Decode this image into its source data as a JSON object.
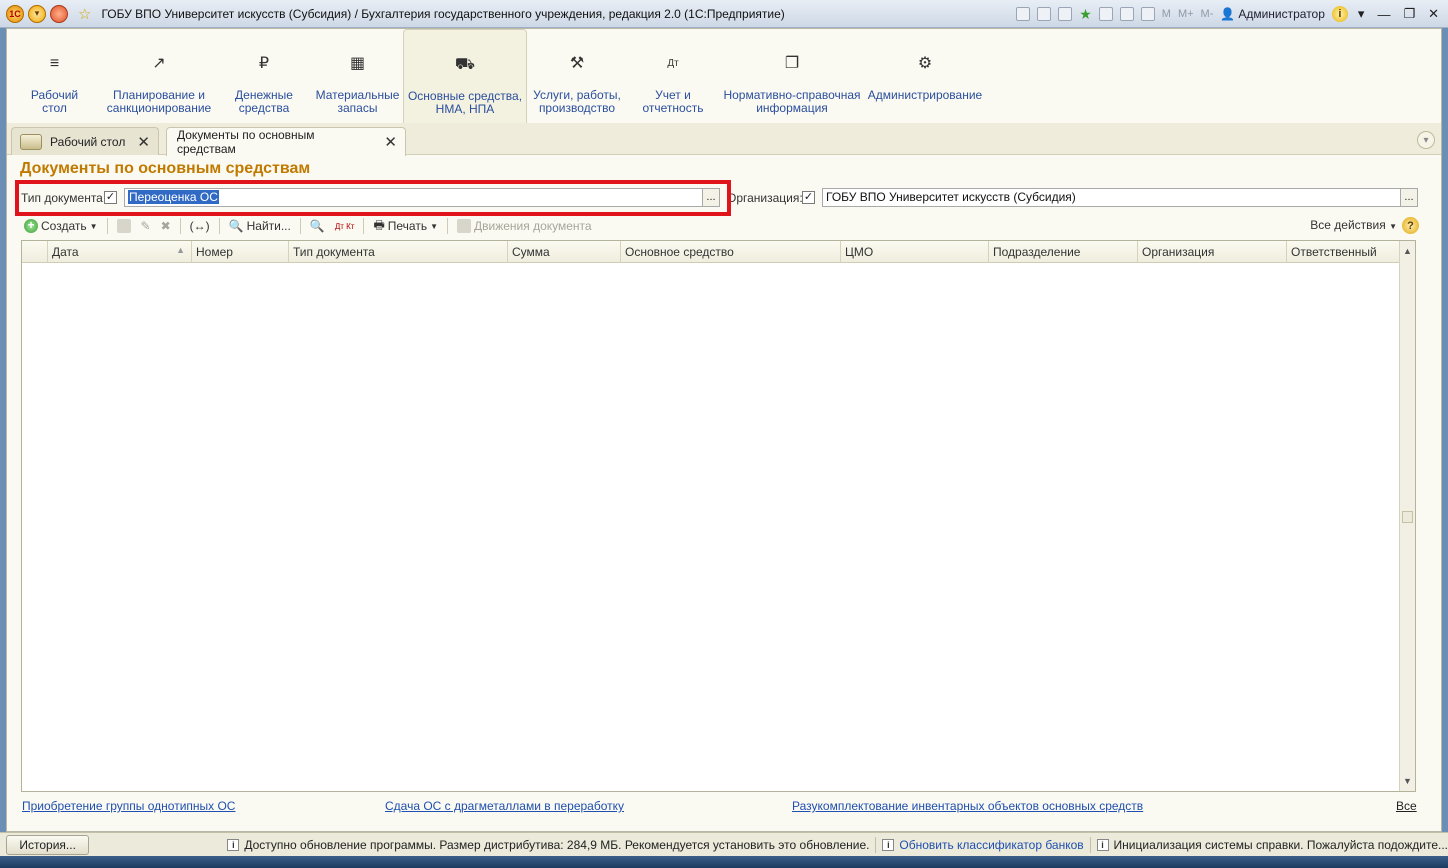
{
  "window": {
    "title": "ГОБУ ВПО Университет искусств (Субсидия) / Бухгалтерия государственного учреждения, редакция 2.0  (1С:Предприятие)",
    "logo_text": "1С",
    "memory_buttons": [
      "M",
      "M+",
      "M-"
    ],
    "user": "Администратор",
    "info_glyph": "i"
  },
  "sections": [
    {
      "label1": "Рабочий",
      "label2": "стол",
      "icon": "menu-lines-icon",
      "glyph": "≡"
    },
    {
      "label1": "Планирование и",
      "label2": "санкционирование",
      "icon": "planning-chart-icon",
      "glyph": "↗"
    },
    {
      "label1": "Денежные",
      "label2": "средства",
      "icon": "ruble-coin-icon",
      "glyph": "₽"
    },
    {
      "label1": "Материальные",
      "label2": "запасы",
      "icon": "grid-blocks-icon",
      "glyph": "▦"
    },
    {
      "label1": "Основные средства,",
      "label2": "НМА, НПА",
      "icon": "truck-icon",
      "glyph": "⛟"
    },
    {
      "label1": "Услуги, работы,",
      "label2": "производство",
      "icon": "tools-icon",
      "glyph": "⚒"
    },
    {
      "label1": "Учет и",
      "label2": "отчетность",
      "icon": "debit-credit-icon",
      "glyph": "Дт"
    },
    {
      "label1": "Нормативно-справочная",
      "label2": "информация",
      "icon": "documents-icon",
      "glyph": "❐"
    },
    {
      "label1": "Администрирование",
      "label2": "",
      "icon": "gear-icon",
      "glyph": "⚙"
    }
  ],
  "tabs": [
    {
      "label": "Рабочий стол",
      "close": "✕"
    },
    {
      "label": "Документы по основным средствам",
      "close": "✕"
    }
  ],
  "page": {
    "title": "Документы по основным средствам"
  },
  "filters": {
    "doc_type_label": "Тип документа:",
    "doc_type_value": "Переоценка ОС",
    "org_label": "Организация:",
    "org_value": "ГОБУ ВПО Университет искусств (Субсидия)",
    "check_glyph": "✓",
    "dots": "..."
  },
  "toolbar": {
    "create": "Создать",
    "find": "Найти...",
    "print": "Печать",
    "movements": "Движения документа",
    "all_actions": "Все действия",
    "help": "?",
    "dtkt": "Дт Кт",
    "binding": "(↔)"
  },
  "table": {
    "columns": [
      "Дата",
      "Номер",
      "Тип документа",
      "Сумма",
      "Основное средство",
      "ЦМО",
      "Подразделение",
      "Организация",
      "Ответственный"
    ],
    "rows": []
  },
  "bottom_links": [
    "Приобретение группы однотипных ОС",
    "Сдача ОС с драгметаллами в переработку",
    "Разукомплектование инвентарных объектов основных средств",
    "Все"
  ],
  "statusbar": {
    "history_button": "История...",
    "info_glyph": "i",
    "update_notice": "Доступно обновление программы. Размер дистрибутива: 284,9 МБ. Рекомендуется установить это обновление.",
    "update_banks": "Обновить классификатор банков",
    "help_init": "Инициализация системы справки. Пожалуйста подождите..."
  }
}
